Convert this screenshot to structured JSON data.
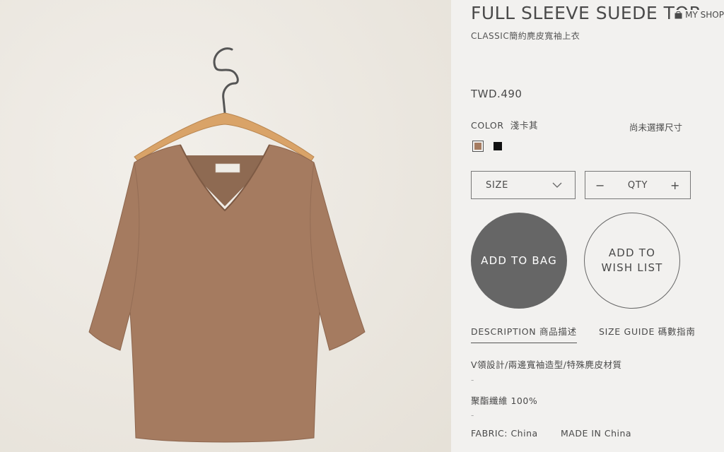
{
  "product": {
    "title": "FULL SLEEVE SUEDE TOP",
    "subtitle": "CLASSIC簡約麂皮寬袖上衣",
    "price": "TWD.490",
    "color_label": "COLOR",
    "color_value": "淺卡其",
    "size_note": "尚未選擇尺寸",
    "swatches": [
      {
        "name": "khaki",
        "color": "#a57b60"
      },
      {
        "name": "black",
        "color": "#111111"
      }
    ]
  },
  "header": {
    "shop_label": "MY SHOP",
    "shop_icon": "shopping-bag-icon"
  },
  "controls": {
    "size_label": "SIZE",
    "size_icon": "chevron-down-icon",
    "qty_label": "QTY",
    "minus": "−",
    "plus": "+"
  },
  "actions": {
    "add_to_bag": "ADD TO BAG",
    "wish_line1": "ADD TO",
    "wish_line2": "WISH LIST"
  },
  "tabs": {
    "description": "DESCRIPTION 商品描述",
    "size_guide": "SIZE GUIDE 碼數指南"
  },
  "description": {
    "line1": "V領設計/兩邊寬袖造型/特殊麂皮材質",
    "sep1": "-",
    "line2": "聚酯纖維 100%",
    "sep2": "-",
    "fabric": "FABRIC: China",
    "made_in": "MADE IN China"
  },
  "colors": {
    "bag_button": "#666666",
    "garment": "#a57b60",
    "background": "#ece8e1"
  }
}
